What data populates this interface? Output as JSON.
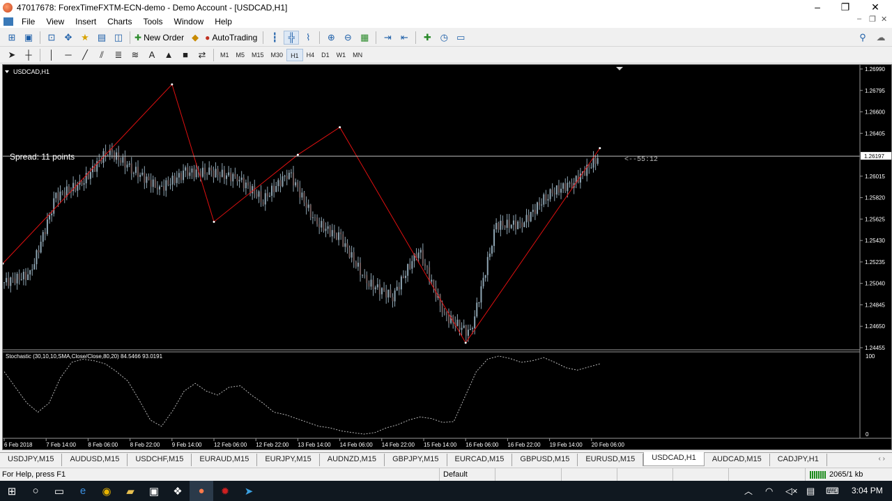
{
  "window": {
    "title": "47017678: ForexTimeFXTM-ECN-demo - Demo Account - [USDCAD,H1]",
    "controls": [
      "–",
      "❐",
      "✕"
    ]
  },
  "menu": [
    "File",
    "View",
    "Insert",
    "Charts",
    "Tools",
    "Window",
    "Help"
  ],
  "toolbar": {
    "new_order_label": "New Order",
    "autotrading_label": "AutoTrading"
  },
  "timeframes": [
    "M1",
    "M5",
    "M15",
    "M30",
    "H1",
    "H4",
    "D1",
    "W1",
    "MN"
  ],
  "active_timeframe": "H1",
  "chart": {
    "symbol_label": "USDCAD,H1",
    "spread_text": "Spread: 11 points",
    "countdown_text": "<--55:12",
    "current_price_label": "1.26197",
    "indicator_label": "Stochastic (30,10,10,SMA,Close/Close,80,20) 84.5466 93.0191",
    "indicator_scale_top": "100",
    "indicator_scale_bottom": "0",
    "price_ticks": [
      "1.26990",
      "1.26795",
      "1.26600",
      "1.26405",
      "1.26015",
      "1.25820",
      "1.25625",
      "1.25430",
      "1.25235",
      "1.25040",
      "1.24845",
      "1.24650",
      "1.24455"
    ],
    "time_ticks": [
      "6 Feb 2018",
      "7 Feb 14:00",
      "8 Feb 06:00",
      "8 Feb 22:00",
      "9 Feb 14:00",
      "12 Feb 06:00",
      "12 Feb 22:00",
      "13 Feb 14:00",
      "14 Feb 06:00",
      "14 Feb 22:00",
      "15 Feb 14:00",
      "16 Feb 06:00",
      "16 Feb 22:00",
      "19 Feb 14:00",
      "20 Feb 06:00"
    ],
    "zigzag_color": "#e01010",
    "price_line_color": "#c0c0c0",
    "candle_up_color": "#8fa6b4",
    "candle_down_color": "#8fa6b4"
  },
  "chart_data": {
    "type": "line",
    "symbol": "USDCAD",
    "timeframe": "H1",
    "x": [
      "6 Feb 2018",
      "7 Feb 14:00",
      "8 Feb 06:00",
      "8 Feb 22:00",
      "9 Feb 14:00",
      "12 Feb 06:00",
      "12 Feb 22:00",
      "13 Feb 14:00",
      "14 Feb 06:00",
      "14 Feb 22:00",
      "15 Feb 14:00",
      "16 Feb 06:00",
      "16 Feb 22:00",
      "19 Feb 14:00",
      "20 Feb 06:00"
    ],
    "ylim": [
      1.24455,
      1.2699
    ],
    "zigzag": [
      {
        "x": "6 Feb 2018",
        "y": 1.2522
      },
      {
        "x": "9 Feb 14:00",
        "y": 1.2685
      },
      {
        "x": "12 Feb 06:00",
        "y": 1.256
      },
      {
        "x": "13 Feb 14:00",
        "y": 1.2621
      },
      {
        "x": "14 Feb 06:00",
        "y": 1.2646
      },
      {
        "x": "16 Feb 06:00",
        "y": 1.245
      },
      {
        "x": "20 Feb 06:00",
        "y": 1.2627
      }
    ],
    "close": [
      1.2505,
      1.2512,
      1.2583,
      1.2595,
      1.2625,
      1.2607,
      1.259,
      1.2605,
      1.2605,
      1.26,
      1.258,
      1.2605,
      1.256,
      1.2545,
      1.2505,
      1.2492,
      1.2535,
      1.2475,
      1.2458,
      1.2557,
      1.2558,
      1.2585,
      1.2596,
      1.262
    ],
    "stochastic": {
      "params": "30,10,10,SMA,Close/Close,80,20",
      "main": 84.5466,
      "signal": 93.0191,
      "range": [
        0,
        100
      ],
      "values": [
        80,
        60,
        40,
        28,
        40,
        72,
        92,
        96,
        94,
        90,
        80,
        68,
        44,
        18,
        10,
        30,
        55,
        65,
        55,
        50,
        60,
        62,
        50,
        40,
        28,
        25,
        20,
        15,
        10,
        8,
        4,
        2,
        0,
        2,
        8,
        12,
        18,
        22,
        20,
        15,
        16,
        48,
        80,
        96,
        100,
        97,
        92,
        94,
        98,
        92,
        85,
        82,
        86,
        90
      ]
    }
  },
  "tabs": [
    "USDJPY,M15",
    "AUDUSD,M15",
    "USDCHF,M15",
    "EURAUD,M15",
    "EURJPY,M15",
    "AUDNZD,M15",
    "GBPJPY,M15",
    "EURCAD,M15",
    "GBPUSD,M15",
    "EURUSD,M15",
    "USDCAD,H1",
    "AUDCAD,M15",
    "CADJPY,H1"
  ],
  "active_tab": "USDCAD,H1",
  "status": {
    "help_text": "For Help, press F1",
    "profile": "Default",
    "traffic": "2065/1 kb"
  },
  "taskbar": {
    "time": "3:04 PM",
    "icons": [
      "windows-start-icon",
      "search-circle-icon",
      "task-view-icon",
      "edge-icon",
      "chrome-icon",
      "file-explorer-icon",
      "store-icon",
      "dropbox-icon",
      "fxtm-terminal-icon",
      "fxtm-red-icon",
      "telegram-icon"
    ]
  }
}
